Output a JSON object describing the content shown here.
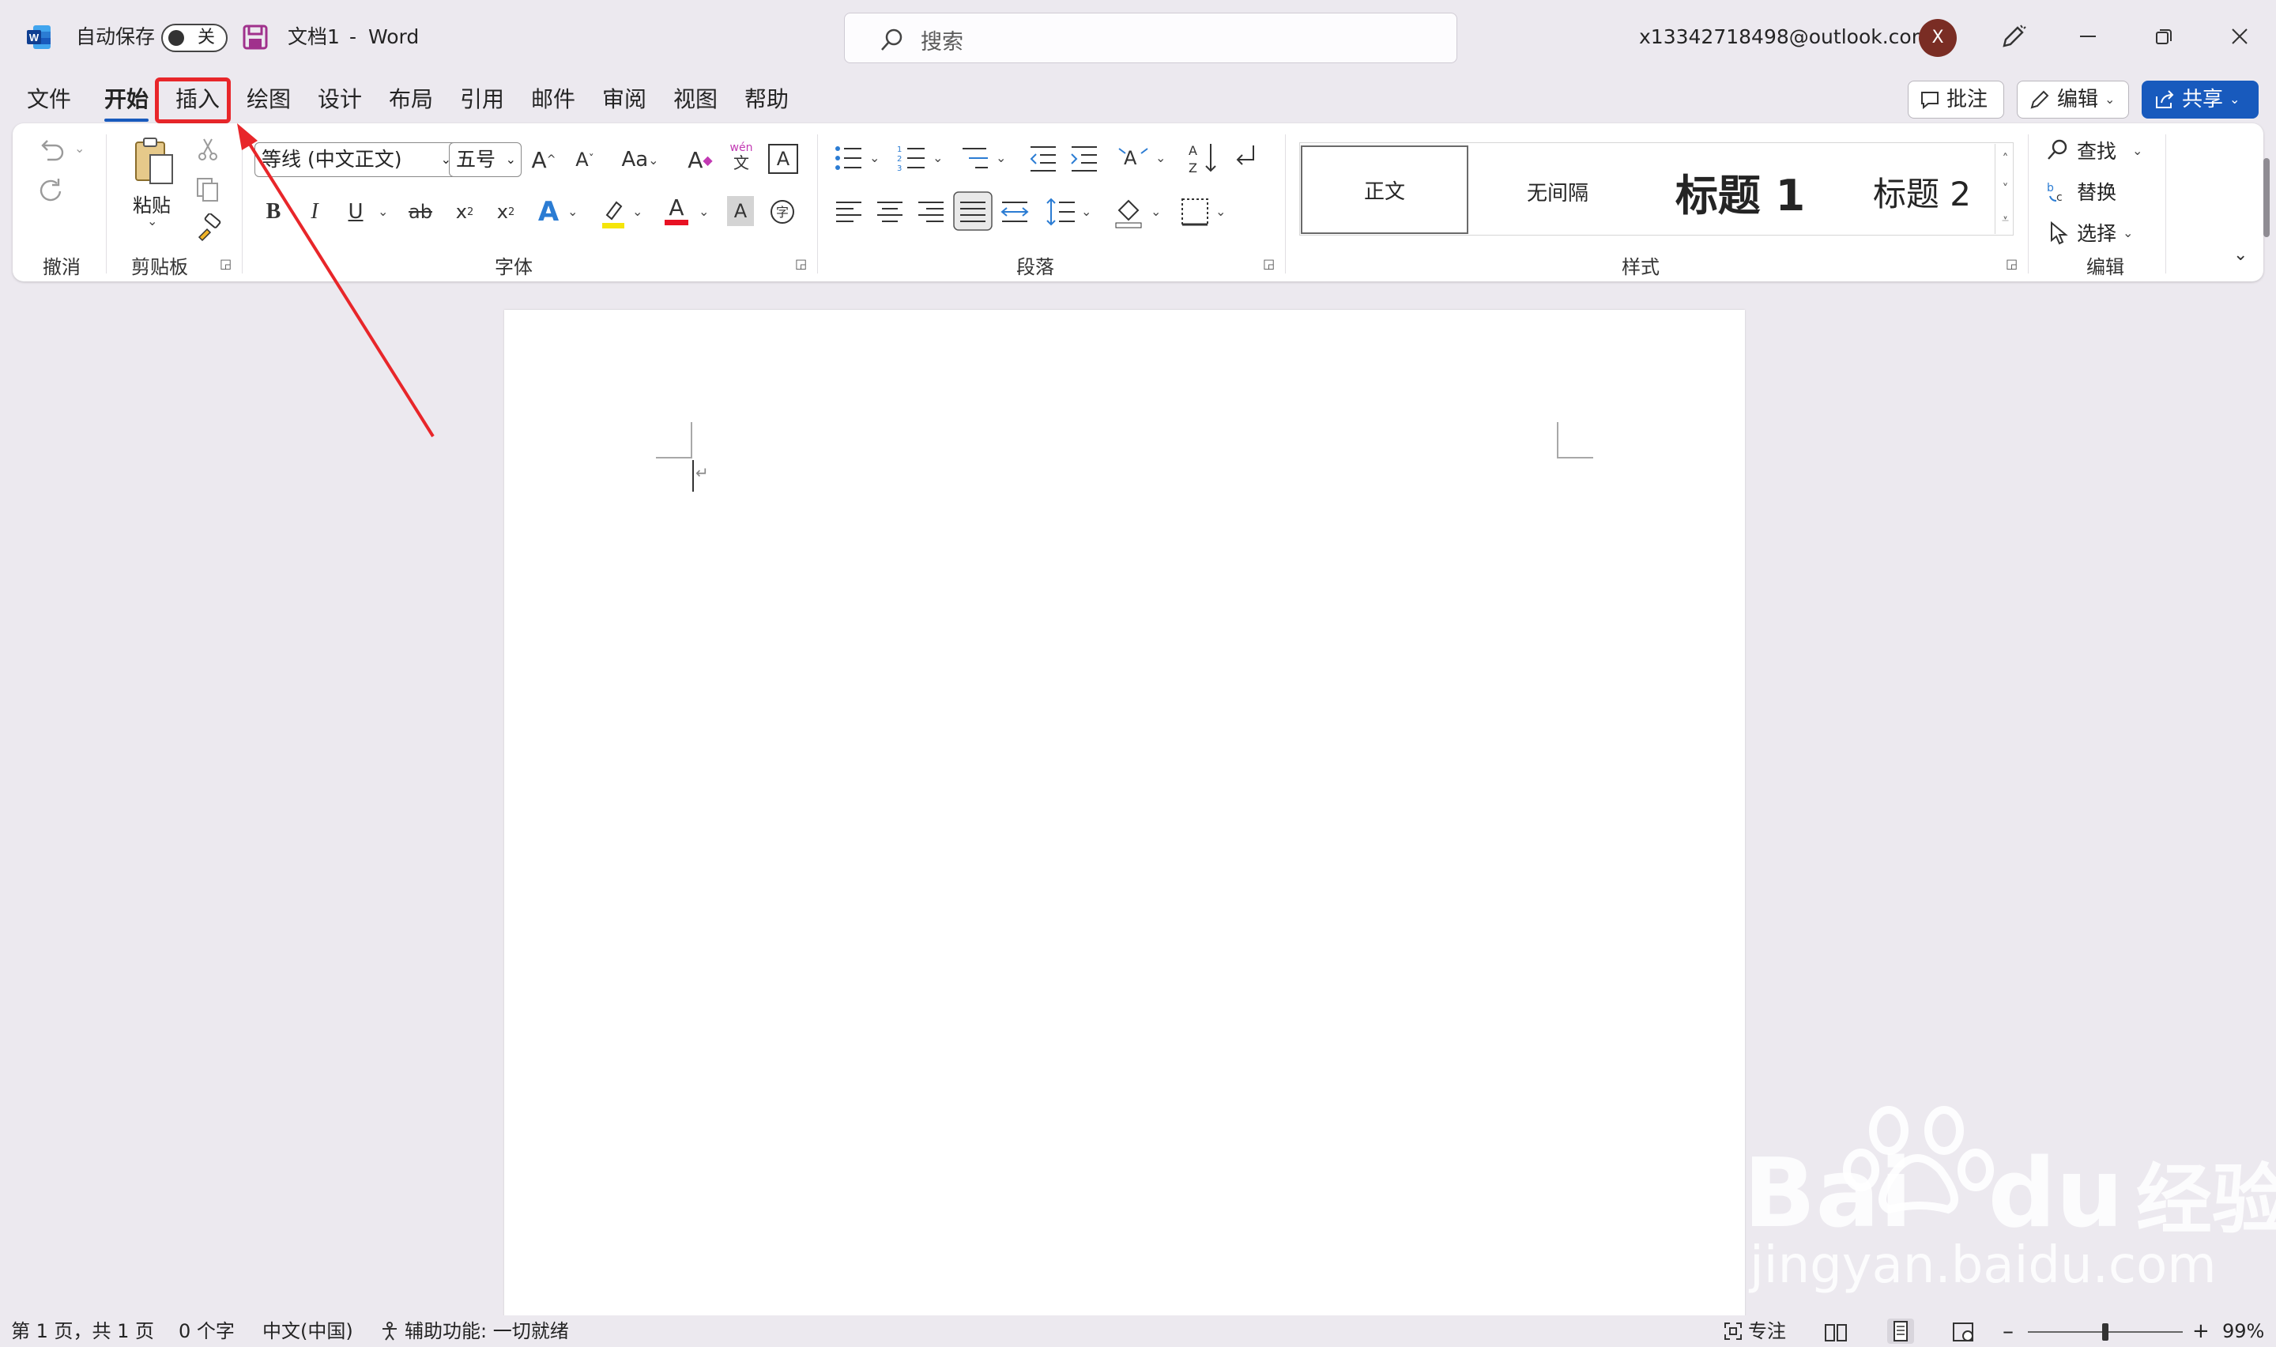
{
  "titlebar": {
    "autosave_label": "自动保存",
    "autosave_state": "关",
    "doc_name": "文档1",
    "separator": "-",
    "app_name": "Word",
    "search_placeholder": "搜索",
    "account_email": "x13342718498@outlook.com",
    "avatar_initial": "X"
  },
  "menu": {
    "tabs": [
      {
        "label": "文件"
      },
      {
        "label": "开始"
      },
      {
        "label": "插入"
      },
      {
        "label": "绘图"
      },
      {
        "label": "设计"
      },
      {
        "label": "布局"
      },
      {
        "label": "引用"
      },
      {
        "label": "邮件"
      },
      {
        "label": "审阅"
      },
      {
        "label": "视图"
      },
      {
        "label": "帮助"
      }
    ],
    "active_tab": "开始",
    "highlighted_tab": "插入",
    "comments_label": "批注",
    "editing_label": "编辑",
    "share_label": "共享"
  },
  "ribbon": {
    "groups": {
      "undo": "撤消",
      "clipboard": "剪贴板",
      "font": "字体",
      "paragraph": "段落",
      "styles": "样式",
      "editing": "编辑"
    },
    "paste_label": "粘贴",
    "font_name": "等线 (中文正文)",
    "font_size": "五号",
    "case_label": "Aa",
    "phonetic_label": "wén",
    "phonetic_char": "文",
    "styles": [
      {
        "label": "正文"
      },
      {
        "label": "无间隔"
      },
      {
        "label": "标题 1"
      },
      {
        "label": "标题 2"
      }
    ],
    "find_label": "查找",
    "replace_label": "替换",
    "select_label": "选择"
  },
  "statusbar": {
    "page_info": "第 1 页，共 1 页",
    "word_count": "0 个字",
    "language": "中文(中国)",
    "accessibility": "辅助功能: 一切就绪",
    "focus_label": "专注",
    "zoom_level": "99%",
    "zoom_fraction": 0.5
  },
  "watermark": {
    "brand": "Bai",
    "brand2": "du",
    "brand_cn": "经验",
    "url": "jingyan.baidu.com"
  },
  "colors": {
    "accent": "#185abd",
    "highlight_box": "#e8262a",
    "highlight_marker": "#f5e50a",
    "font_color": "#e81123",
    "avatar": "#7a2d24"
  }
}
